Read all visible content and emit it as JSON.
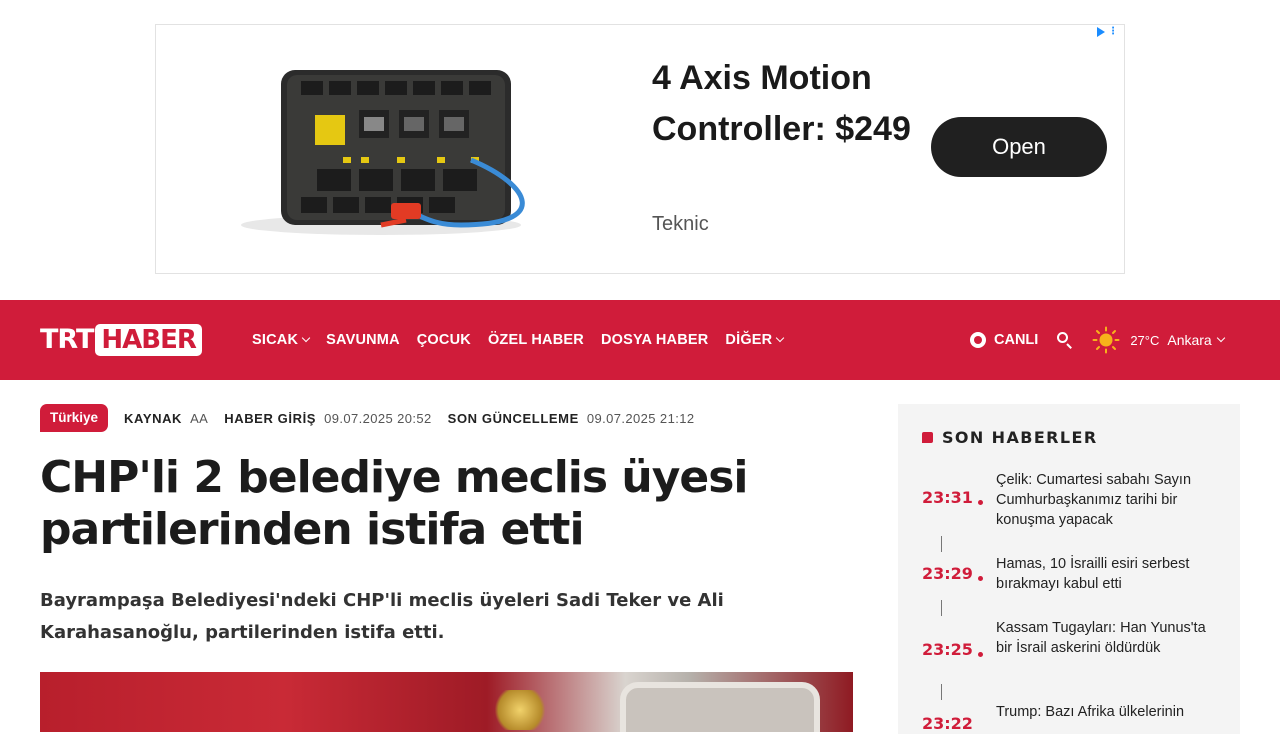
{
  "ad": {
    "headline": "4 Axis Motion Controller: $249",
    "brand": "Teknic",
    "cta": "Open",
    "adchoices_icon": "adchoices-icon"
  },
  "header": {
    "logo_left": "TRT",
    "logo_right": "HABER",
    "nav": [
      "SICAK",
      "SAVUNMA",
      "ÇOCUK",
      "ÖZEL HABER",
      "DOSYA HABER",
      "DİĞER"
    ],
    "live_label": "CANLI",
    "temperature": "27°C",
    "city": "Ankara",
    "brand_color": "#d01c3a"
  },
  "article": {
    "category": "Türkiye",
    "source_label": "KAYNAK",
    "source_value": "AA",
    "published_label": "HABER GİRİŞ",
    "published_value": "09.07.2025 20:52",
    "updated_label": "SON GÜNCELLEME",
    "updated_value": "09.07.2025 21:12",
    "title": "CHP'li 2 belediye meclis üyesi partilerinden istifa etti",
    "lead": "Bayrampaşa Belediyesi'ndeki CHP'li meclis üyeleri Sadi Teker ve Ali Karahasanoğlu, partilerinden istifa etti."
  },
  "sidebar": {
    "title": "SON HABERLER",
    "items": [
      {
        "time": "23:31",
        "text": "Çelik: Cumartesi sabahı Sayın Cumhurbaşkanımız tarihi bir konuşma yapacak"
      },
      {
        "time": "23:29",
        "text": "Hamas, 10 İsrailli esiri serbest bırakmayı kabul etti"
      },
      {
        "time": "23:25",
        "text": "Kassam Tugayları: Han Yunus'ta bir İsrail askerini öldürdük"
      },
      {
        "time": "23:22",
        "text": "Trump: Bazı Afrika ülkelerinin"
      }
    ]
  }
}
